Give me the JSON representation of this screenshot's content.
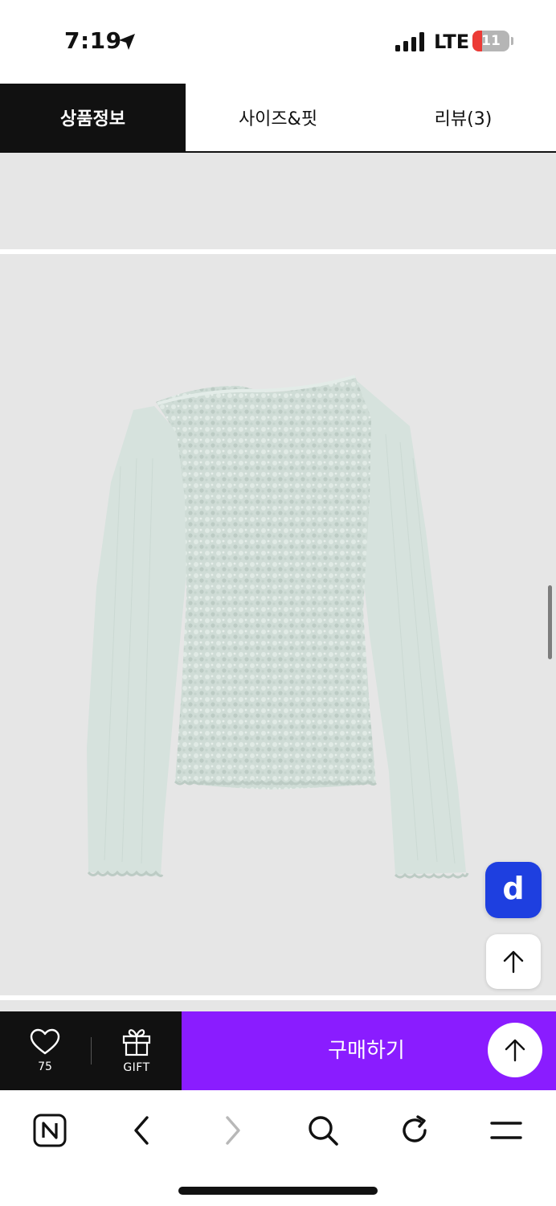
{
  "status_bar": {
    "time": "7:19",
    "network": "LTE",
    "battery_level": "11",
    "battery_fraction": 0.11,
    "icons": [
      "location-arrow-icon",
      "signal-icon",
      "battery-icon"
    ]
  },
  "tabs": [
    {
      "label": "상품정보",
      "active": true
    },
    {
      "label": "사이즈&핏",
      "active": false
    },
    {
      "label": "리뷰(3)",
      "active": false
    }
  ],
  "product_image": {
    "subject": "long-sleeve-mint-textured-top",
    "background_color": "#e6e6e6",
    "garment_color": "#cfdcd6"
  },
  "floating_buttons": {
    "d_label": "d",
    "d_color": "#1e3fe0",
    "scroll_top_icon": "arrow-up-icon"
  },
  "buy_bar": {
    "like_icon": "heart-icon",
    "like_count": "75",
    "gift_icon": "gift-icon",
    "gift_label": "GIFT",
    "buy_label": "구매하기",
    "buy_color": "#8a1cff",
    "scroll_top_icon": "arrow-up-icon"
  },
  "browser_toolbar": {
    "items": [
      "naver-home-icon",
      "back-icon",
      "forward-icon",
      "search-icon",
      "reload-icon",
      "menu-icon"
    ]
  }
}
